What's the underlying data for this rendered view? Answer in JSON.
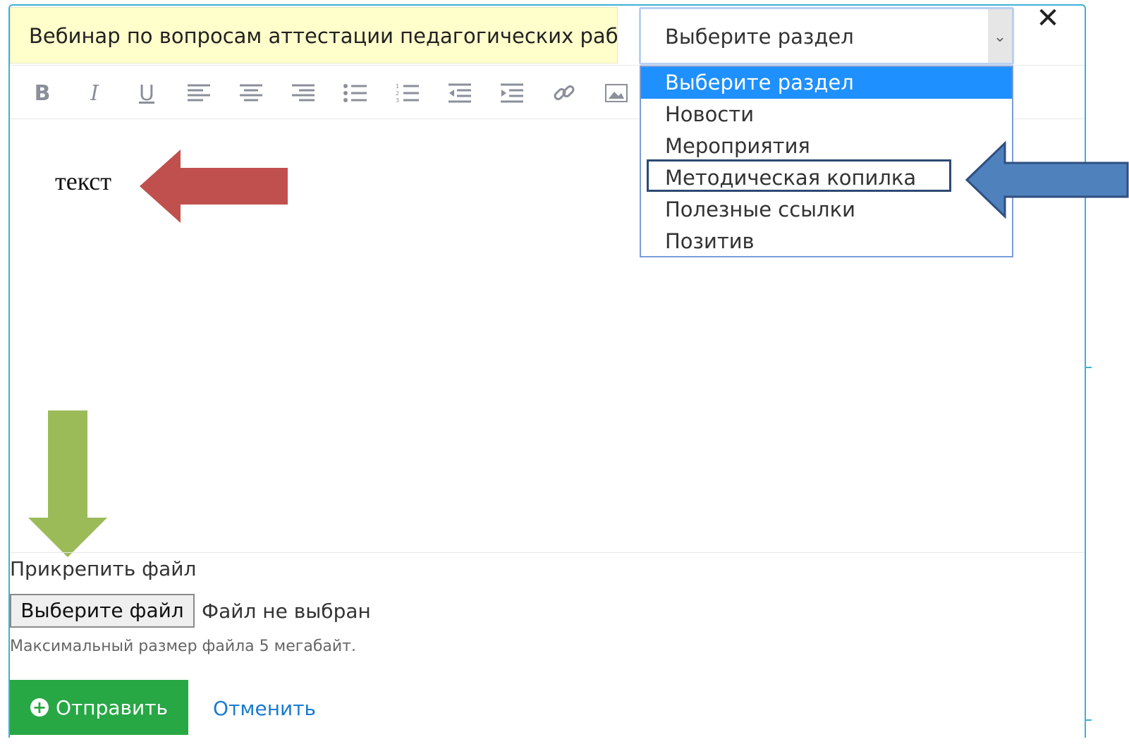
{
  "form": {
    "title_value": "Вебинар по вопросам аттестации педагогических раб",
    "section_select": {
      "value": "Выберите раздел",
      "options": [
        "Выберите раздел",
        "Новости",
        "Мероприятия",
        "Методическая копилка",
        "Полезные ссылки",
        "Позитив"
      ],
      "selected_index": 0,
      "highlighted_option": "Методическая копилка"
    },
    "close_symbol": "✕"
  },
  "toolbar": {
    "bold": "B",
    "italic": "I",
    "underline": "U",
    "icons": [
      "align-left-icon",
      "align-center-icon",
      "align-right-icon",
      "bullet-list-icon",
      "numbered-list-icon",
      "outdent-icon",
      "indent-icon",
      "link-icon",
      "image-icon"
    ]
  },
  "editor": {
    "content": "текст"
  },
  "attachment": {
    "label": "Прикрепить файл",
    "button_label": "Выберите файл",
    "status": "Файл не выбран",
    "hint": "Максимальный размер файла 5 мегабайт."
  },
  "actions": {
    "submit_label": "Отправить",
    "cancel_label": "Отменить"
  },
  "annotations": {
    "red_arrow_color": "#c0504d",
    "blue_arrow_color": "#4f81bd",
    "green_arrow_color": "#9bbb59"
  },
  "colors": {
    "submit": "#28a745",
    "selected_option": "#1e90ff",
    "frame": "#3cb1d6",
    "title_bg": "#ffffcc"
  }
}
